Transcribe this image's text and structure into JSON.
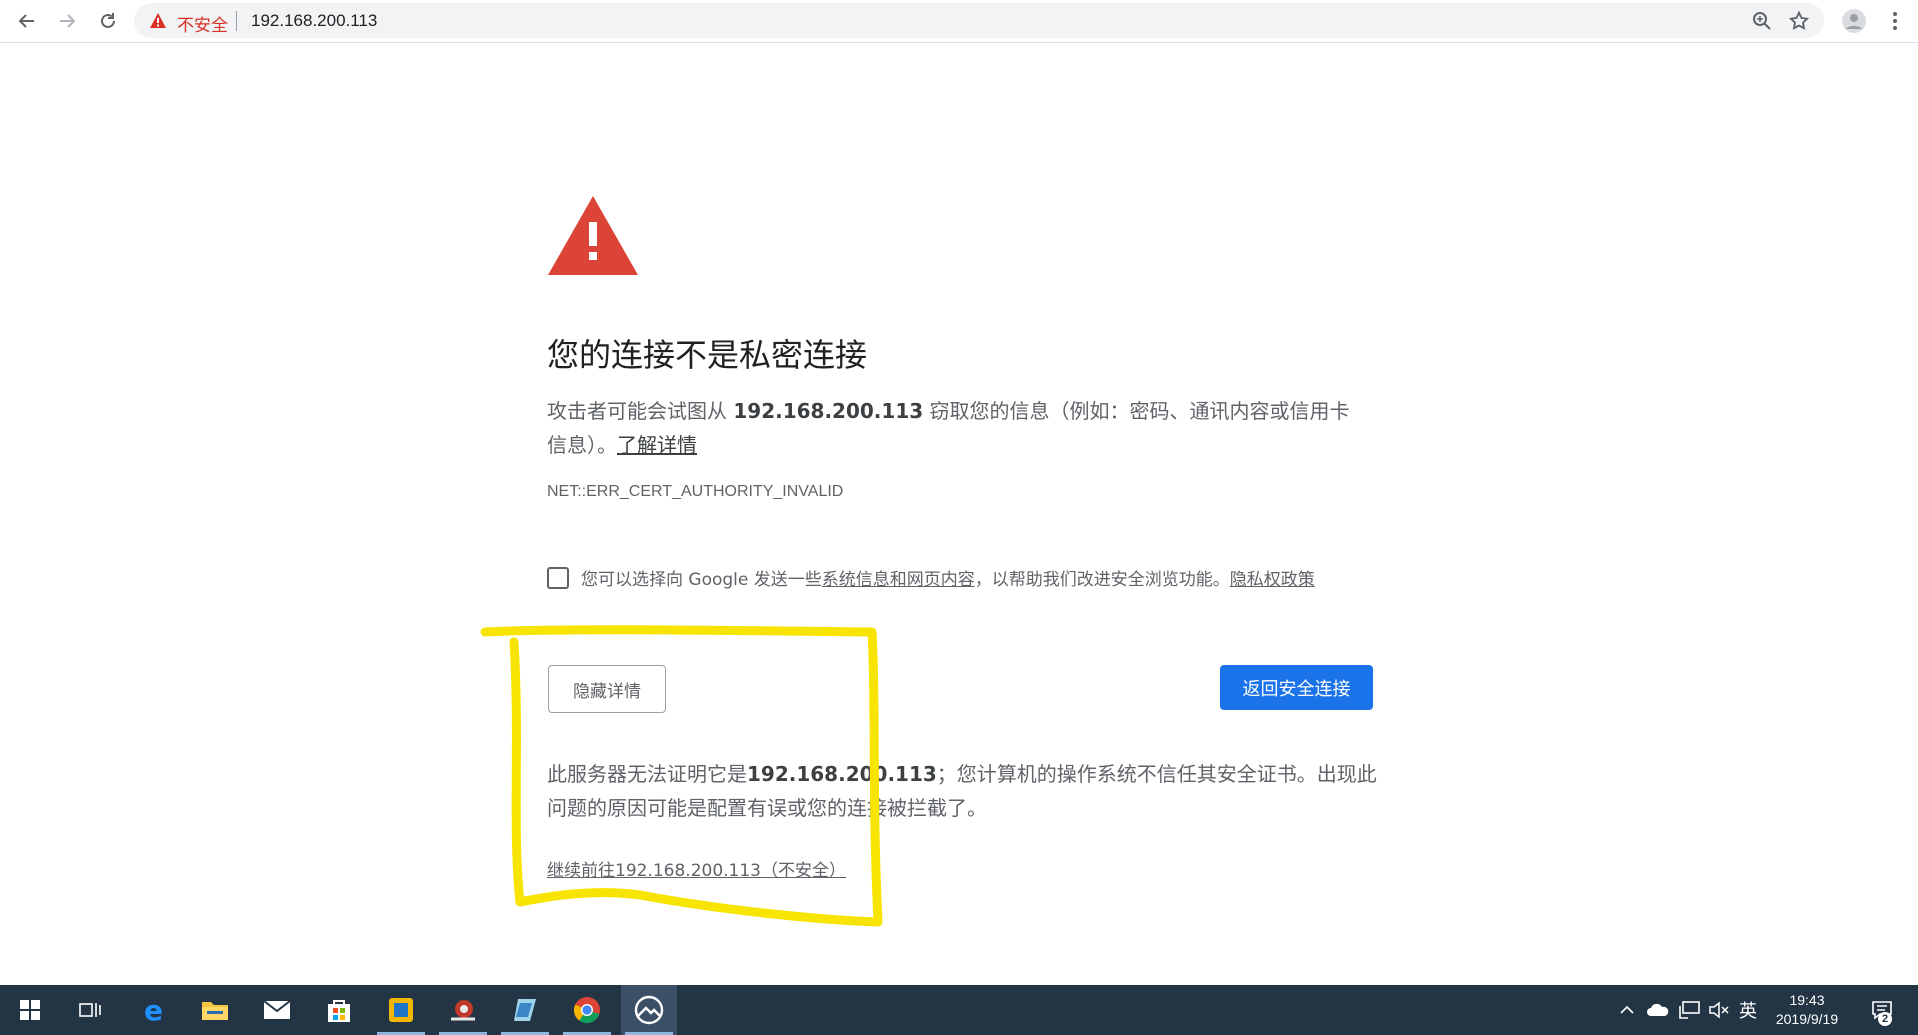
{
  "browser": {
    "security_label": "不安全",
    "url": "192.168.200.113"
  },
  "interstitial": {
    "heading": "您的连接不是私密连接",
    "para1_prefix": "攻击者可能会试图从 ",
    "para1_host": "192.168.200.113",
    "para1_suffix": " 窃取您的信息（例如：密码、通讯内容或信用卡信息）。",
    "learn_more": "了解详情",
    "error_code": "NET::ERR_CERT_AUTHORITY_INVALID",
    "optin_prefix": "您可以选择向 Google 发送一些",
    "optin_link": "系统信息和网页内容",
    "optin_middle": "，以帮助我们改进安全浏览功能。",
    "privacy_link": "隐私权政策",
    "hide_details_label": "隐藏详情",
    "back_to_safety_label": "返回安全连接",
    "para2_prefix": "此服务器无法证明它是",
    "para2_host": "192.168.200.113",
    "para2_suffix": "；您计算机的操作系统不信任其安全证书。出现此问题的原因可能是配置有误或您的连接被拦截了。",
    "proceed_link": "继续前往192.168.200.113（不安全）"
  },
  "annotation": {
    "color": "#f7e400"
  },
  "taskbar": {
    "apps": [
      "windows-start",
      "task-view",
      "edge",
      "file-explorer",
      "mail",
      "store",
      "app-yellow",
      "app-snail",
      "app-pen",
      "chrome",
      "app-active"
    ],
    "ime_label": "英",
    "time": "19:43",
    "date": "2019/9/19",
    "notification_count": "2"
  },
  "colors": {
    "accent_blue": "#1a73e8",
    "danger_red": "#d93025",
    "taskbar_bg": "#233545"
  }
}
